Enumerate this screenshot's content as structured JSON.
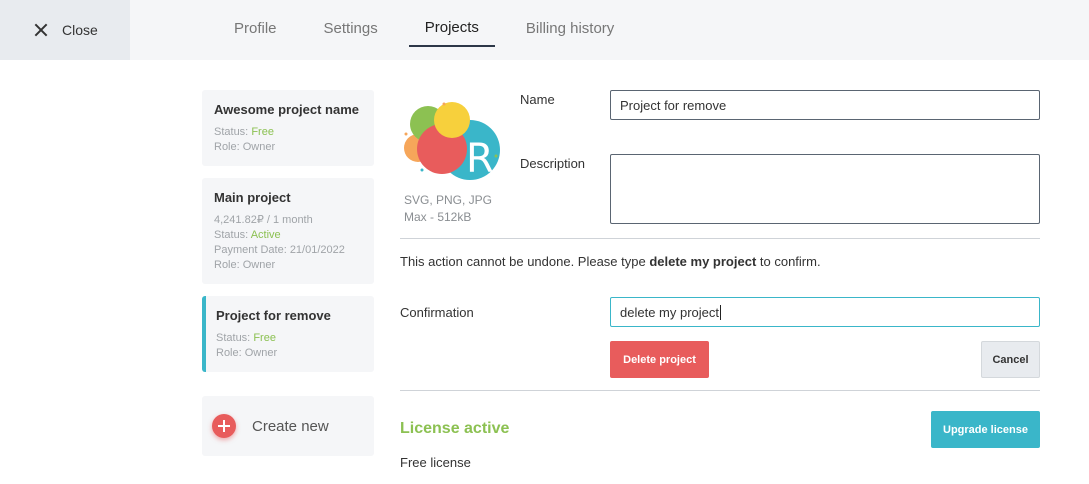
{
  "header": {
    "close_label": "Close",
    "tabs": [
      {
        "label": "Profile"
      },
      {
        "label": "Settings"
      },
      {
        "label": "Projects"
      },
      {
        "label": "Billing history"
      }
    ]
  },
  "projects": [
    {
      "title": "Awesome project name",
      "status_label": "Status:",
      "status": "Free",
      "role": "Role: Owner"
    },
    {
      "title": "Main project",
      "price": "4,241.82₽ / 1 month",
      "status_label": "Status:",
      "status": "Active",
      "payment": "Payment Date: 21/01/2022",
      "role": "Role: Owner"
    },
    {
      "title": "Project for remove",
      "status_label": "Status:",
      "status": "Free",
      "role": "Role: Owner"
    }
  ],
  "create_new_label": "Create new",
  "logo": {
    "formats": "SVG, PNG, JPG",
    "max_size": "Max - 512kB"
  },
  "form": {
    "name_label": "Name",
    "name_value": "Project for remove",
    "description_label": "Description",
    "description_value": "",
    "warning_prefix": "This action cannot be undone. Please type ",
    "warning_phrase": "delete my project",
    "warning_suffix": " to confirm.",
    "confirmation_label": "Confirmation",
    "confirmation_value": "delete my project",
    "delete_button": "Delete project",
    "cancel_button": "Cancel"
  },
  "license": {
    "title": "License active",
    "type": "Free license",
    "upgrade_button": "Upgrade license"
  },
  "colors": {
    "accent": "#3ab6c9",
    "danger": "#e85c5c",
    "success": "#8cc152"
  }
}
